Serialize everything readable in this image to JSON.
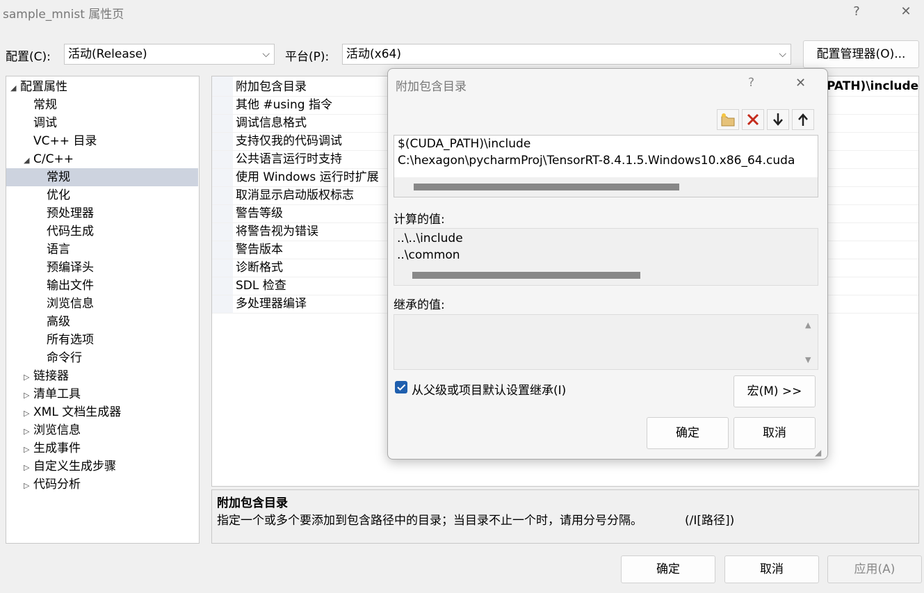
{
  "window": {
    "title": "sample_mnist 属性页",
    "help": "?",
    "close": "✕"
  },
  "config": {
    "config_label": "配置(C):",
    "config_value": "活动(Release)",
    "platform_label": "平台(P):",
    "platform_value": "活动(x64)",
    "manager_button": "配置管理器(O)..."
  },
  "tree": {
    "items": [
      "配置属性",
      "常规",
      "调试",
      "VC++ 目录",
      "C/C++",
      "常规",
      "优化",
      "预处理器",
      "代码生成",
      "语言",
      "预编译头",
      "输出文件",
      "浏览信息",
      "高级",
      "所有选项",
      "命令行",
      "链接器",
      "清单工具",
      "XML 文档生成器",
      "浏览信息",
      "生成事件",
      "自定义生成步骤",
      "代码分析"
    ]
  },
  "properties": {
    "rows": [
      "附加包含目录",
      "其他 #using 指令",
      "调试信息格式",
      "支持仅我的代码调试",
      "公共语言运行时支持",
      "使用 Windows 运行时扩展",
      "取消显示启动版权标志",
      "警告等级",
      "将警告视为错误",
      "警告版本",
      "诊断格式",
      "SDL 检查",
      "多处理器编译"
    ],
    "first_value_partial": "PATH)\\include;"
  },
  "description": {
    "title": "附加包含目录",
    "text": "指定一个或多个要添加到包含路径中的目录；当目录不止一个时，请用分号分隔。",
    "switch": "(/I[路径])"
  },
  "footer": {
    "ok": "确定",
    "cancel": "取消",
    "apply": "应用(A)"
  },
  "dialog": {
    "title": "附加包含目录",
    "help": "?",
    "close": "✕",
    "toolbar_icons": [
      "new-line-icon",
      "delete-icon",
      "move-down-icon",
      "move-up-icon"
    ],
    "entries": [
      "$(CUDA_PATH)\\include",
      "C:\\hexagon\\pycharmProj\\TensorRT-8.4.1.5.Windows10.x86_64.cuda"
    ],
    "evaluated_label": "计算的值:",
    "evaluated": [
      "..\\..\\include",
      "..\\common"
    ],
    "inherited_label": "继承的值:",
    "inherit_checkbox": "从父级或项目默认设置继承(I)",
    "inherit_checked": true,
    "macros_button": "宏(M) >>",
    "ok": "确定",
    "cancel": "取消"
  },
  "colors": {
    "accent": "#1f5fae",
    "selection": "#cdd3df",
    "delete": "#c42b1c"
  }
}
